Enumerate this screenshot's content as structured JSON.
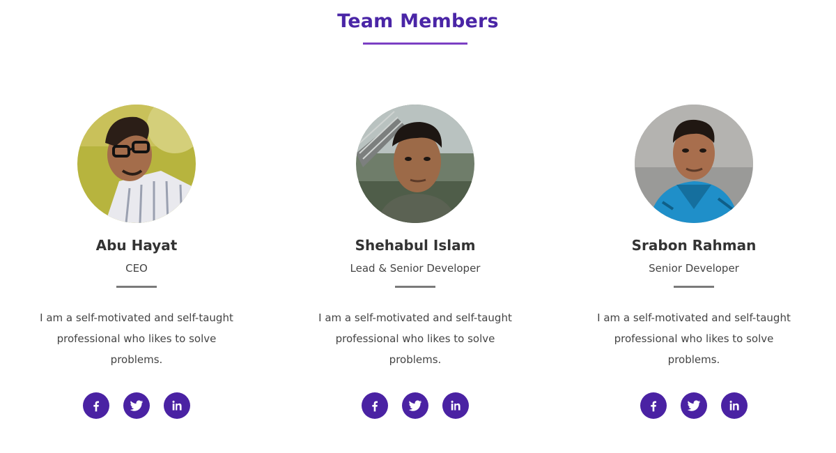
{
  "section": {
    "title": "Team Members",
    "accent_color": "#4a25a6",
    "underline_color": "#7b3fc4"
  },
  "members": [
    {
      "name": "Abu Hayat",
      "role": "CEO",
      "bio_line1": "I am a self-motivated and self-taught",
      "bio_line2": "professional who likes to solve problems.",
      "photo": "profile-photo",
      "socials": [
        "facebook-icon",
        "twitter-icon",
        "linkedin-icon"
      ]
    },
    {
      "name": "Shehabul Islam",
      "role": "Lead & Senior Developer",
      "bio_line1": "I am a self-motivated and self-taught",
      "bio_line2": "professional who likes to solve problems.",
      "photo": "profile-photo",
      "socials": [
        "facebook-icon",
        "twitter-icon",
        "linkedin-icon"
      ]
    },
    {
      "name": "Srabon Rahman",
      "role": "Senior Developer",
      "bio_line1": "I am a self-motivated and self-taught",
      "bio_line2": "professional who likes to solve problems.",
      "photo": "profile-photo",
      "socials": [
        "facebook-icon",
        "twitter-icon",
        "linkedin-icon"
      ]
    }
  ],
  "social_button_color": "#4a22a3"
}
